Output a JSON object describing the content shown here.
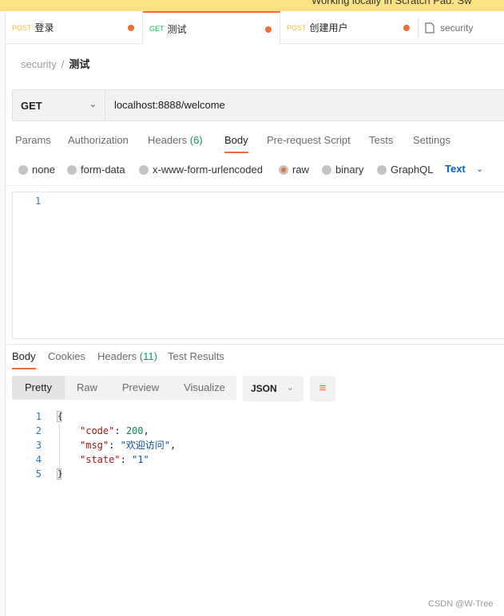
{
  "banner": {
    "text": "Working locally in Scratch Pad. Sw"
  },
  "tabs": [
    {
      "method": "POST",
      "name": "登录",
      "method_color": "#f6b93b",
      "unsaved": true
    },
    {
      "method": "GET",
      "name": "测试",
      "method_color": "#0cbb52",
      "unsaved": true,
      "active": true
    },
    {
      "method": "POST",
      "name": "创建用户",
      "method_color": "#f6b93b",
      "unsaved": true
    },
    {
      "name": "security",
      "icon": "collection-icon"
    }
  ],
  "breadcrumb": {
    "parent": "security",
    "separator": "/",
    "current": "测试"
  },
  "request": {
    "method": "GET",
    "url": "localhost:8888/welcome"
  },
  "request_tabs": [
    {
      "label": "Params"
    },
    {
      "label": "Authorization"
    },
    {
      "label": "Headers",
      "count": "(6)"
    },
    {
      "label": "Body",
      "active": true
    },
    {
      "label": "Pre-request Script"
    },
    {
      "label": "Tests"
    },
    {
      "label": "Settings"
    }
  ],
  "body_types": [
    {
      "label": "none"
    },
    {
      "label": "form-data"
    },
    {
      "label": "x-www-form-urlencoded"
    },
    {
      "label": "raw",
      "selected": true
    },
    {
      "label": "binary"
    },
    {
      "label": "GraphQL"
    }
  ],
  "raw_type": "Text",
  "editor": {
    "line_numbers": [
      "1"
    ]
  },
  "response_tabs": [
    {
      "label": "Body",
      "active": true
    },
    {
      "label": "Cookies"
    },
    {
      "label": "Headers",
      "count": "(11)"
    },
    {
      "label": "Test Results"
    }
  ],
  "view_modes": [
    {
      "label": "Pretty",
      "active": true
    },
    {
      "label": "Raw"
    },
    {
      "label": "Preview"
    },
    {
      "label": "Visualize"
    }
  ],
  "format": "JSON",
  "response_lines": [
    {
      "n": "1",
      "text": "{"
    },
    {
      "n": "2",
      "key": "\"code\"",
      "sep": ": ",
      "value": "200",
      "value_type": "number",
      "trail": ","
    },
    {
      "n": "3",
      "key": "\"msg\"",
      "sep": ": ",
      "value": "\"欢迎访问\"",
      "value_type": "string",
      "trail": ","
    },
    {
      "n": "4",
      "key": "\"state\"",
      "sep": ": ",
      "value": "\"1\"",
      "value_type": "string",
      "trail": ""
    },
    {
      "n": "5",
      "text": "}"
    }
  ],
  "watermark": "CSDN @W-Tree",
  "colors": {
    "accent": "#f26b3a",
    "banner": "#fde283",
    "link": "#0265d2",
    "count": "#0c9d58"
  }
}
